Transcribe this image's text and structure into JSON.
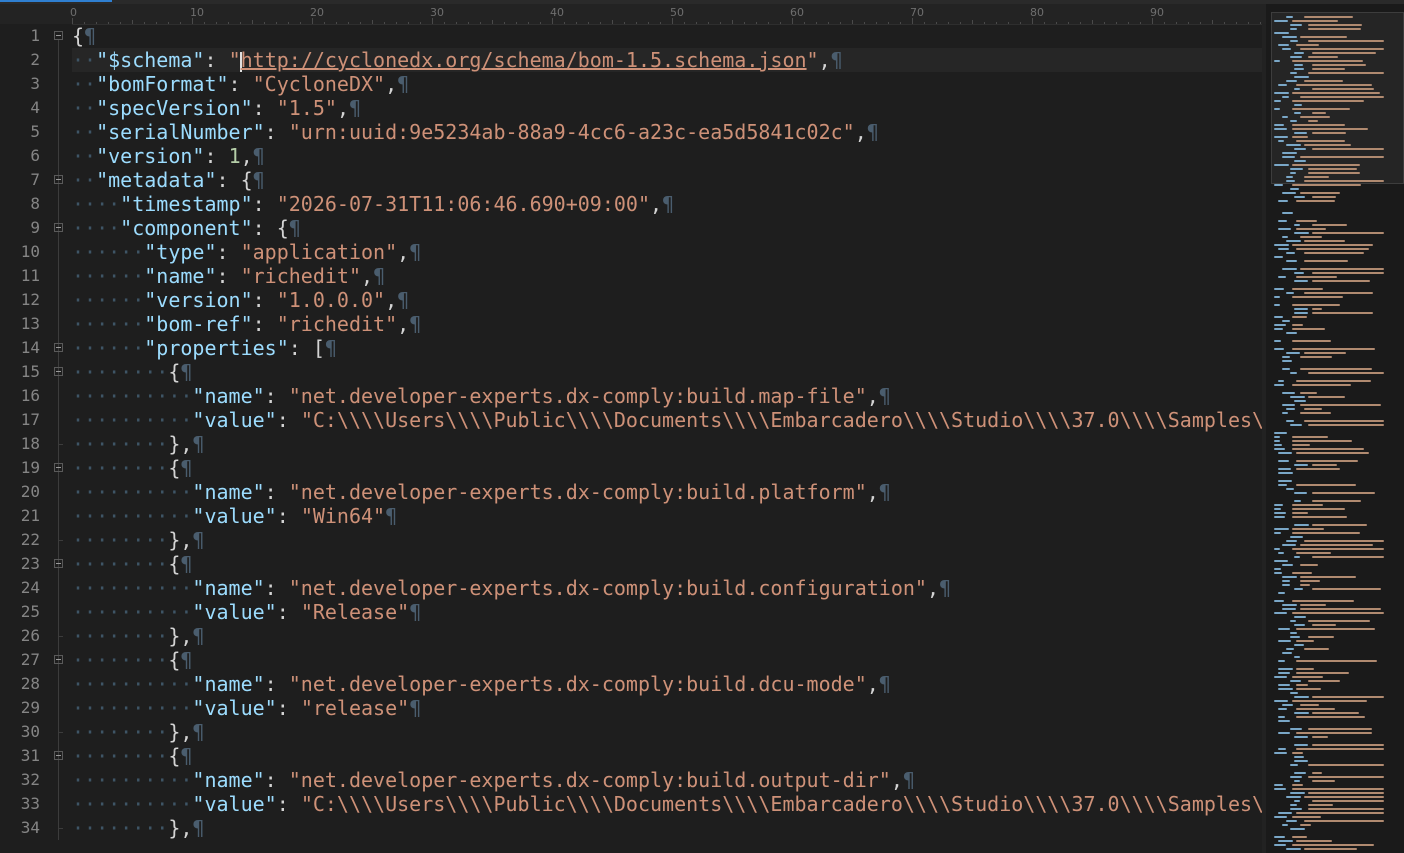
{
  "editor": {
    "ruler_labels": [
      "0",
      "10",
      "20",
      "30",
      "40",
      "50",
      "60",
      "70",
      "80",
      "90"
    ],
    "line_numbers": [
      "1",
      "2",
      "3",
      "4",
      "5",
      "6",
      "7",
      "8",
      "9",
      "10",
      "11",
      "12",
      "13",
      "14",
      "15",
      "16",
      "17",
      "18",
      "19",
      "20",
      "21",
      "22",
      "23",
      "24",
      "25",
      "26",
      "27",
      "28",
      "29",
      "30",
      "31",
      "32",
      "33",
      "34"
    ],
    "pilcrow": "¶",
    "lines": [
      {
        "ind": 0,
        "t": [
          [
            "p",
            "{"
          ]
        ],
        "fold": true
      },
      {
        "ind": 1,
        "t": [
          [
            "k",
            "\"$schema\""
          ],
          [
            "p",
            ": "
          ],
          [
            "s",
            "\""
          ],
          [
            "c",
            ""
          ],
          [
            "u",
            "http://cyclonedx.org/schema/bom-1.5.schema.json"
          ],
          [
            "s",
            "\""
          ],
          [
            "p",
            ","
          ]
        ]
      },
      {
        "ind": 1,
        "t": [
          [
            "k",
            "\"bomFormat\""
          ],
          [
            "p",
            ": "
          ],
          [
            "s",
            "\"CycloneDX\""
          ],
          [
            "p",
            ","
          ]
        ]
      },
      {
        "ind": 1,
        "t": [
          [
            "k",
            "\"specVersion\""
          ],
          [
            "p",
            ": "
          ],
          [
            "s",
            "\"1.5\""
          ],
          [
            "p",
            ","
          ]
        ]
      },
      {
        "ind": 1,
        "t": [
          [
            "k",
            "\"serialNumber\""
          ],
          [
            "p",
            ": "
          ],
          [
            "s",
            "\"urn:uuid:9e5234ab-88a9-4cc6-a23c-ea5d5841c02c\""
          ],
          [
            "p",
            ","
          ]
        ]
      },
      {
        "ind": 1,
        "t": [
          [
            "k",
            "\"version\""
          ],
          [
            "p",
            ": "
          ],
          [
            "n",
            "1"
          ],
          [
            "p",
            ","
          ]
        ]
      },
      {
        "ind": 1,
        "t": [
          [
            "k",
            "\"metadata\""
          ],
          [
            "p",
            ": {"
          ]
        ],
        "fold": true
      },
      {
        "ind": 2,
        "t": [
          [
            "k",
            "\"timestamp\""
          ],
          [
            "p",
            ": "
          ],
          [
            "s",
            "\"2026-07-31T11:06:46.690+09:00\""
          ],
          [
            "p",
            ","
          ]
        ]
      },
      {
        "ind": 2,
        "t": [
          [
            "k",
            "\"component\""
          ],
          [
            "p",
            ": {"
          ]
        ],
        "fold": true
      },
      {
        "ind": 3,
        "t": [
          [
            "k",
            "\"type\""
          ],
          [
            "p",
            ": "
          ],
          [
            "s",
            "\"application\""
          ],
          [
            "p",
            ","
          ]
        ]
      },
      {
        "ind": 3,
        "t": [
          [
            "k",
            "\"name\""
          ],
          [
            "p",
            ": "
          ],
          [
            "s",
            "\"richedit\""
          ],
          [
            "p",
            ","
          ]
        ]
      },
      {
        "ind": 3,
        "t": [
          [
            "k",
            "\"version\""
          ],
          [
            "p",
            ": "
          ],
          [
            "s",
            "\"1.0.0.0\""
          ],
          [
            "p",
            ","
          ]
        ]
      },
      {
        "ind": 3,
        "t": [
          [
            "k",
            "\"bom-ref\""
          ],
          [
            "p",
            ": "
          ],
          [
            "s",
            "\"richedit\""
          ],
          [
            "p",
            ","
          ]
        ]
      },
      {
        "ind": 3,
        "t": [
          [
            "k",
            "\"properties\""
          ],
          [
            "p",
            ": ["
          ]
        ],
        "fold": true
      },
      {
        "ind": 4,
        "t": [
          [
            "p",
            "{"
          ]
        ],
        "fold": true
      },
      {
        "ind": 5,
        "t": [
          [
            "k",
            "\"name\""
          ],
          [
            "p",
            ": "
          ],
          [
            "s",
            "\"net.developer-experts.dx-comply:build.map-file\""
          ],
          [
            "p",
            ","
          ]
        ]
      },
      {
        "ind": 5,
        "t": [
          [
            "k",
            "\"value\""
          ],
          [
            "p",
            ": "
          ],
          [
            "s",
            "\"C:\\\\\\\\Users\\\\\\\\Public\\\\\\\\Documents\\\\\\\\Embarcadero\\\\\\\\Studio\\\\\\\\37.0\\\\\\\\Samples\\\\"
          ]
        ],
        "nopil": true
      },
      {
        "ind": 4,
        "t": [
          [
            "p",
            "},"
          ]
        ],
        "end": true
      },
      {
        "ind": 4,
        "t": [
          [
            "p",
            "{"
          ]
        ],
        "fold": true
      },
      {
        "ind": 5,
        "t": [
          [
            "k",
            "\"name\""
          ],
          [
            "p",
            ": "
          ],
          [
            "s",
            "\"net.developer-experts.dx-comply:build.platform\""
          ],
          [
            "p",
            ","
          ]
        ]
      },
      {
        "ind": 5,
        "t": [
          [
            "k",
            "\"value\""
          ],
          [
            "p",
            ": "
          ],
          [
            "s",
            "\"Win64\""
          ]
        ]
      },
      {
        "ind": 4,
        "t": [
          [
            "p",
            "},"
          ]
        ],
        "end": true
      },
      {
        "ind": 4,
        "t": [
          [
            "p",
            "{"
          ]
        ],
        "fold": true
      },
      {
        "ind": 5,
        "t": [
          [
            "k",
            "\"name\""
          ],
          [
            "p",
            ": "
          ],
          [
            "s",
            "\"net.developer-experts.dx-comply:build.configuration\""
          ],
          [
            "p",
            ","
          ]
        ]
      },
      {
        "ind": 5,
        "t": [
          [
            "k",
            "\"value\""
          ],
          [
            "p",
            ": "
          ],
          [
            "s",
            "\"Release\""
          ]
        ]
      },
      {
        "ind": 4,
        "t": [
          [
            "p",
            "},"
          ]
        ],
        "end": true
      },
      {
        "ind": 4,
        "t": [
          [
            "p",
            "{"
          ]
        ],
        "fold": true
      },
      {
        "ind": 5,
        "t": [
          [
            "k",
            "\"name\""
          ],
          [
            "p",
            ": "
          ],
          [
            "s",
            "\"net.developer-experts.dx-comply:build.dcu-mode\""
          ],
          [
            "p",
            ","
          ]
        ]
      },
      {
        "ind": 5,
        "t": [
          [
            "k",
            "\"value\""
          ],
          [
            "p",
            ": "
          ],
          [
            "s",
            "\"release\""
          ]
        ]
      },
      {
        "ind": 4,
        "t": [
          [
            "p",
            "},"
          ]
        ],
        "end": true
      },
      {
        "ind": 4,
        "t": [
          [
            "p",
            "{"
          ]
        ],
        "fold": true
      },
      {
        "ind": 5,
        "t": [
          [
            "k",
            "\"name\""
          ],
          [
            "p",
            ": "
          ],
          [
            "s",
            "\"net.developer-experts.dx-comply:build.output-dir\""
          ],
          [
            "p",
            ","
          ]
        ]
      },
      {
        "ind": 5,
        "t": [
          [
            "k",
            "\"value\""
          ],
          [
            "p",
            ": "
          ],
          [
            "s",
            "\"C:\\\\\\\\Users\\\\\\\\Public\\\\\\\\Documents\\\\\\\\Embarcadero\\\\\\\\Studio\\\\\\\\37.0\\\\\\\\Samples\\\\"
          ]
        ],
        "nopil": true
      },
      {
        "ind": 4,
        "t": [
          [
            "p",
            "},"
          ]
        ],
        "end": true
      }
    ]
  },
  "colors": {
    "background": "#1e1e1e",
    "key": "#9cdcfe",
    "string": "#ce9178",
    "number": "#b5cea8",
    "whitespace_marker": "#3e5566",
    "tab_accent": "#2f7fd1"
  }
}
